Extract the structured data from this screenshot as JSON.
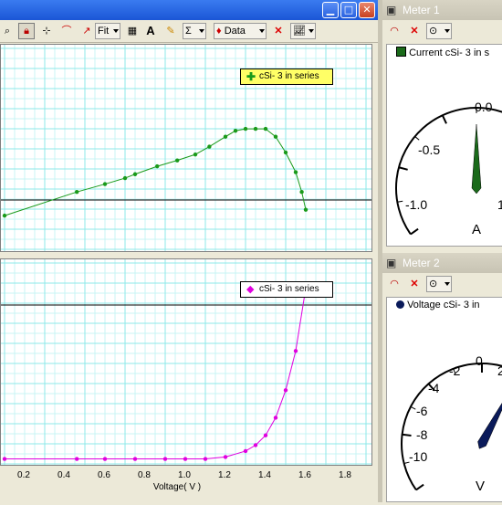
{
  "main": {
    "toolbar": {
      "fit_label": "Fit",
      "data_label": "Data"
    },
    "x_axis": {
      "label": "Voltage( V )",
      "ticks": [
        "0.2",
        "0.4",
        "0.6",
        "0.8",
        "1.0",
        "1.2",
        "1.4",
        "1.6",
        "1.8"
      ]
    },
    "top_legend": "cSi- 3 in series",
    "bottom_legend": "cSi- 3 in series",
    "colors": {
      "top_series": "#1a9a1a",
      "bottom_series": "#e000e0",
      "grid": "#8ee8e8",
      "top_legend_bg": "#ffff66"
    }
  },
  "chart_data": [
    {
      "type": "line",
      "title": "",
      "legend": "cSi- 3 in series",
      "xlabel": "Voltage( V )",
      "xlim": [
        0.1,
        1.9
      ],
      "x": [
        0.1,
        0.46,
        0.6,
        0.7,
        0.75,
        0.86,
        0.96,
        1.05,
        1.12,
        1.2,
        1.25,
        1.3,
        1.35,
        1.4,
        1.45,
        1.5,
        1.55,
        1.58,
        1.6
      ],
      "y": [
        0.18,
        0.3,
        0.34,
        0.37,
        0.39,
        0.43,
        0.46,
        0.49,
        0.53,
        0.58,
        0.61,
        0.62,
        0.62,
        0.62,
        0.58,
        0.5,
        0.4,
        0.3,
        0.21
      ],
      "grid": true
    },
    {
      "type": "line",
      "title": "",
      "legend": "cSi- 3 in series",
      "xlabel": "Voltage( V )",
      "xlim": [
        0.1,
        1.9
      ],
      "x": [
        0.1,
        0.46,
        0.6,
        0.75,
        0.9,
        1.0,
        1.1,
        1.2,
        1.3,
        1.35,
        1.4,
        1.45,
        1.5,
        1.55,
        1.6
      ],
      "y": [
        0.03,
        0.03,
        0.03,
        0.03,
        0.03,
        0.03,
        0.03,
        0.04,
        0.07,
        0.1,
        0.15,
        0.24,
        0.38,
        0.58,
        0.9
      ],
      "grid": true
    }
  ],
  "meter1": {
    "title": "Meter 1",
    "legend": "Current  cSi- 3 in s",
    "scale": [
      "-1.0",
      "-0.5",
      "0.0",
      "1"
    ],
    "unit": "A",
    "value": 0.0
  },
  "meter2": {
    "title": "Meter 2",
    "legend": "Voltage  cSi- 3 in",
    "scale": [
      "-10",
      "-8",
      "-6",
      "-4",
      "-2",
      "0",
      "2"
    ],
    "unit": "V",
    "value": 1.6
  }
}
